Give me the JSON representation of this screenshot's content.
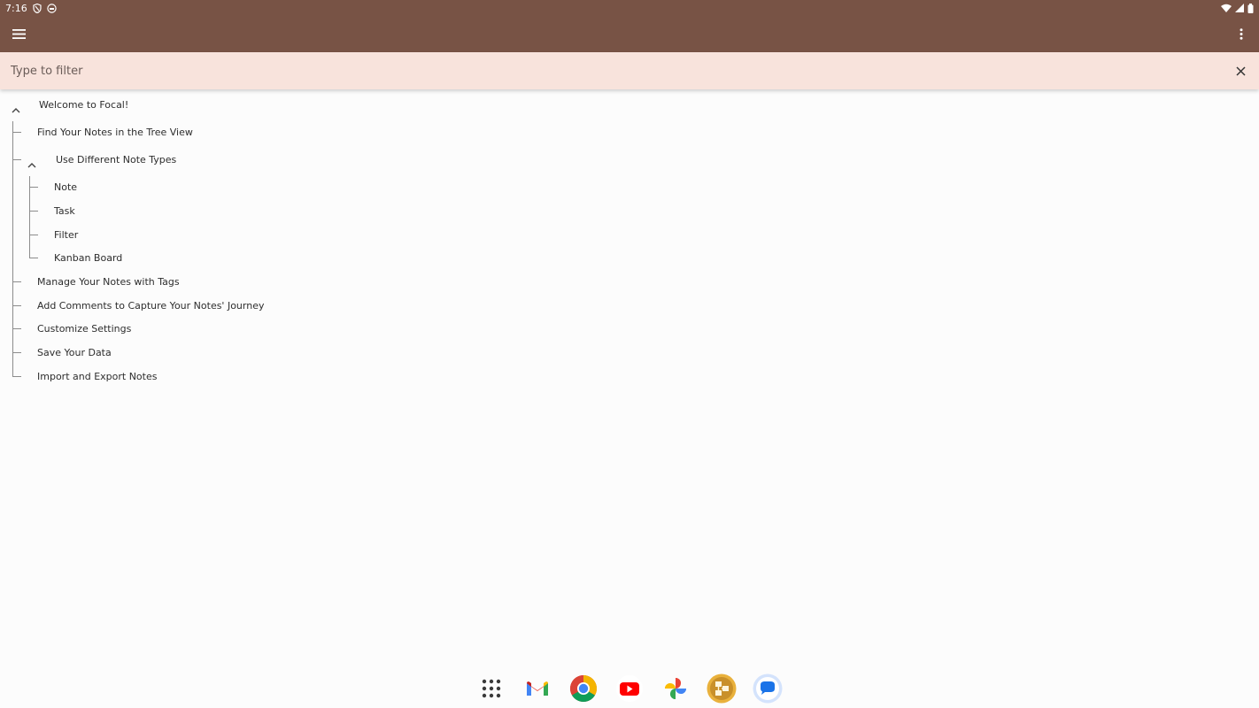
{
  "status_bar": {
    "time": "7:16",
    "left_icons": [
      "vpn-shield-icon",
      "notification-icon"
    ],
    "right_icons": [
      "wifi-icon",
      "signal-icon",
      "battery-icon"
    ]
  },
  "app_bar": {
    "background_color": "#785345",
    "menu_icon": "hamburger-menu-icon",
    "overflow_icon": "more-vert-icon"
  },
  "filter": {
    "placeholder": "Type to filter",
    "value": "",
    "clear_icon": "close-icon",
    "background_color": "#f8e3dc"
  },
  "tree": {
    "root": {
      "label": "Welcome to Focal!",
      "expanded": true,
      "children": [
        {
          "label": "Find Your Notes in the Tree View"
        },
        {
          "label": "Use Different Note Types",
          "expanded": true,
          "children": [
            {
              "label": "Note"
            },
            {
              "label": "Task"
            },
            {
              "label": "Filter"
            },
            {
              "label": "Kanban Board"
            }
          ]
        },
        {
          "label": "Manage Your Notes with Tags"
        },
        {
          "label": "Add Comments to Capture Your Notes' Journey"
        },
        {
          "label": "Customize Settings"
        },
        {
          "label": "Save Your Data"
        },
        {
          "label": "Import and Export Notes"
        }
      ]
    }
  },
  "dock": {
    "apps": [
      {
        "name": "app-drawer",
        "icon": "grid-dots-icon"
      },
      {
        "name": "gmail",
        "icon": "gmail-icon"
      },
      {
        "name": "chrome",
        "icon": "chrome-icon"
      },
      {
        "name": "youtube",
        "icon": "youtube-icon"
      },
      {
        "name": "photos",
        "icon": "photos-pinwheel-icon"
      },
      {
        "name": "focal",
        "icon": "focal-tree-icon"
      },
      {
        "name": "messages",
        "icon": "messages-bubble-icon"
      }
    ]
  }
}
